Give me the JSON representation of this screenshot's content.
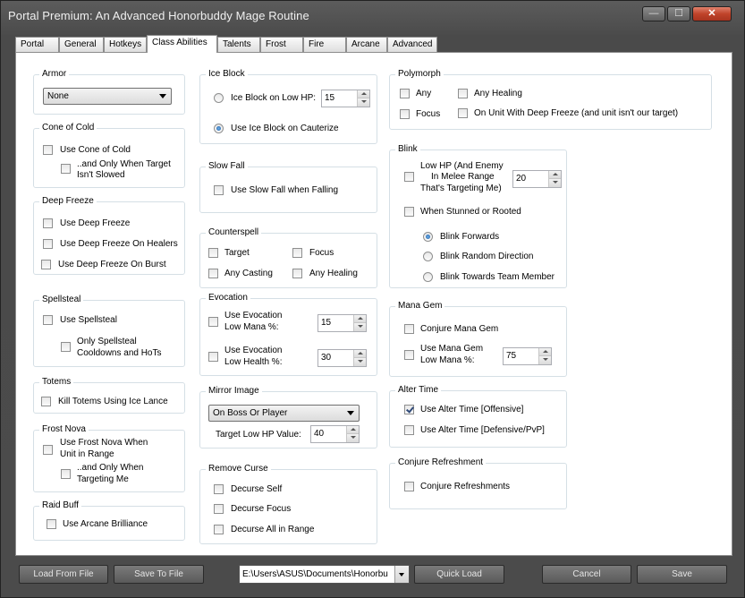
{
  "window": {
    "title": "Portal Premium: An Advanced Honorbuddy Mage Routine",
    "minimize": "—",
    "maximize": "☐",
    "close": "✕"
  },
  "tabs": [
    "Portal",
    "General",
    "Hotkeys",
    "Class Abilities",
    "Talents",
    "Frost",
    "Fire",
    "Arcane",
    "Advanced"
  ],
  "active_tab": "Class Abilities",
  "armor": {
    "title": "Armor",
    "value": "None"
  },
  "cone_of_cold": {
    "title": "Cone of Cold",
    "use": "Use Cone of Cold",
    "only_when_target_line1": "..and Only When Target",
    "only_when_target_line2": "Isn't Slowed"
  },
  "deep_freeze": {
    "title": "Deep Freeze",
    "use": "Use Deep Freeze",
    "on_healers": "Use Deep Freeze On Healers",
    "on_burst": "Use Deep Freeze On Burst"
  },
  "spellsteal": {
    "title": "Spellsteal",
    "use": "Use Spellsteal",
    "only_line1": "Only Spellsteal",
    "only_line2": "Cooldowns and HoTs"
  },
  "totems": {
    "title": "Totems",
    "kill": "Kill Totems Using Ice Lance"
  },
  "frost_nova": {
    "title": "Frost Nova",
    "use_line1": "Use Frost Nova When",
    "use_line2": "Unit in Range",
    "only_line1": "..and Only When",
    "only_line2": "Targeting Me"
  },
  "raid_buff": {
    "title": "Raid Buff",
    "use": "Use Arcane Brilliance"
  },
  "ice_block": {
    "title": "Ice Block",
    "low_hp": "Ice Block on Low HP:",
    "low_hp_value": "15",
    "cauterize": "Use Ice Block on Cauterize"
  },
  "slow_fall": {
    "title": "Slow Fall",
    "use": "Use Slow Fall when Falling"
  },
  "counterspell": {
    "title": "Counterspell",
    "target": "Target",
    "focus": "Focus",
    "any_casting": "Any Casting",
    "any_healing": "Any Healing"
  },
  "evocation": {
    "title": "Evocation",
    "mana_line1": "Use Evocation",
    "mana_line2": "Low Mana %:",
    "mana_value": "15",
    "health_line1": "Use Evocation",
    "health_line2": "Low Health %:",
    "health_value": "30"
  },
  "mirror_image": {
    "title": "Mirror Image",
    "mode": "On Boss Or Player",
    "target_low_hp": "Target Low HP Value:",
    "target_low_hp_value": "40"
  },
  "remove_curse": {
    "title": "Remove Curse",
    "self": "Decurse Self",
    "focus": "Decurse Focus",
    "all": "Decurse All in Range"
  },
  "polymorph": {
    "title": "Polymorph",
    "any": "Any",
    "any_healing": "Any Healing",
    "focus": "Focus",
    "deep_freeze": "On Unit With Deep Freeze (and unit isn't our target)"
  },
  "blink": {
    "title": "Blink",
    "low_hp_line1": "Low HP (And Enemy",
    "low_hp_line2": "In Melee Range",
    "low_hp_line3": "That's Targeting Me)",
    "low_hp_value": "20",
    "stunned": "When Stunned or Rooted",
    "forwards": "Blink Forwards",
    "random": "Blink Random Direction",
    "team": "Blink Towards Team Member"
  },
  "mana_gem": {
    "title": "Mana Gem",
    "conjure": "Conjure Mana Gem",
    "use_line1": "Use Mana Gem",
    "use_line2": "Low Mana %:",
    "use_value": "75"
  },
  "alter_time": {
    "title": "Alter Time",
    "offensive": "Use Alter Time [Offensive]",
    "defensive": "Use Alter Time [Defensive/PvP]"
  },
  "conjure_refreshment": {
    "title": "Conjure Refreshment",
    "conjure": "Conjure Refreshments"
  },
  "footer": {
    "load": "Load From File",
    "save_to": "Save To File",
    "path": "E:\\Users\\ASUS\\Documents\\Honorbu",
    "quick_load": "Quick Load",
    "cancel": "Cancel",
    "save": "Save"
  }
}
